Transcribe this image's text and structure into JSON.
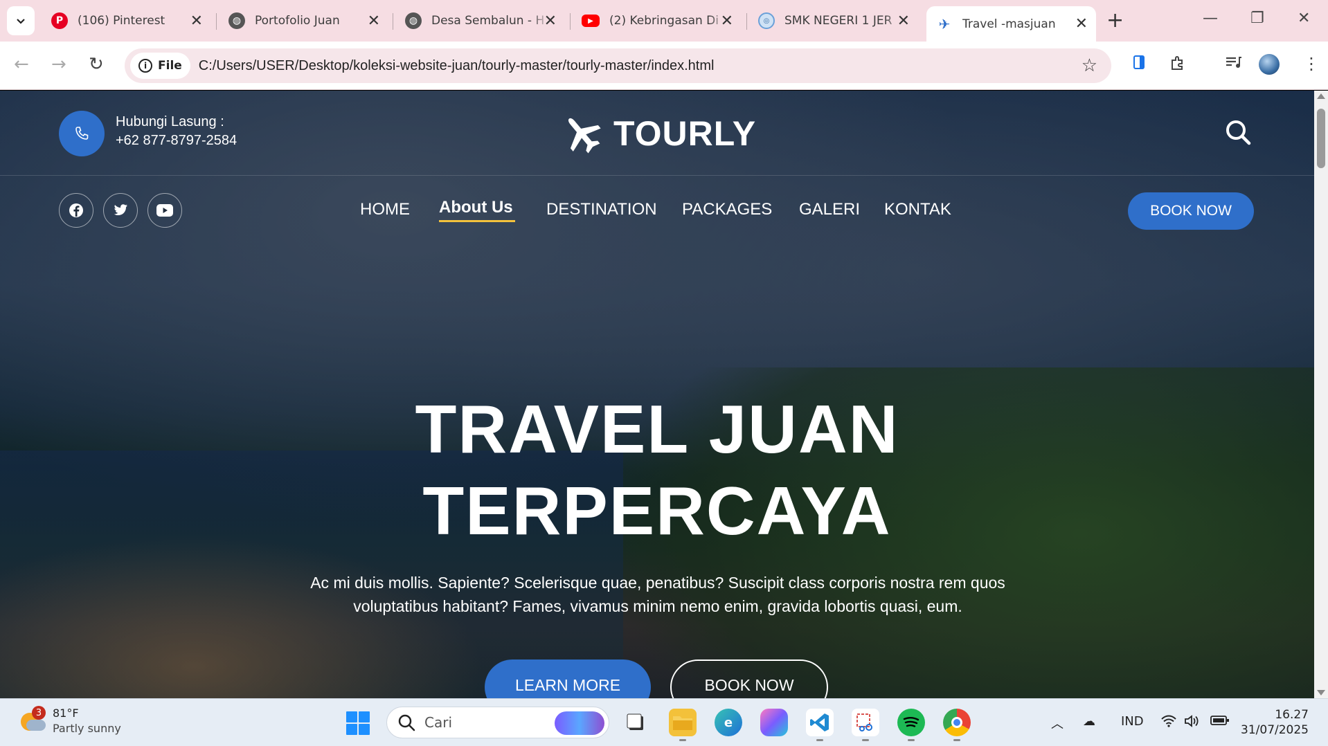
{
  "browser": {
    "tabs": [
      {
        "title": "(106) Pinterest",
        "icon": "pinterest-icon",
        "color": "#e60023"
      },
      {
        "title": "Portofolio Juan",
        "icon": "globe-icon",
        "color": "#555555"
      },
      {
        "title": "Desa Sembalun - H",
        "icon": "globe-icon",
        "color": "#555555"
      },
      {
        "title": "(2) Kebringasan Di",
        "icon": "youtube-icon",
        "color": "#ff0000"
      },
      {
        "title": "SMK NEGERI 1 JER",
        "icon": "school-icon",
        "color": "#6aa0d8"
      },
      {
        "title": "Travel -masjuan",
        "icon": "plane-icon",
        "color": "#2f6fca"
      }
    ],
    "new_tab": "+",
    "site_chip": "File",
    "url": "C:/Users/USER/Desktop/koleksi-website-juan/tourly-master/tourly-master/index.html"
  },
  "site": {
    "contact_label": "Hubungi Lasung :",
    "contact_phone": "+62 877-8797-2584",
    "logo": "TOURLY",
    "social": [
      "facebook-icon",
      "twitter-icon",
      "youtube-icon"
    ],
    "menu": [
      {
        "label": "HOME",
        "active": false
      },
      {
        "label": "About Us",
        "active": true
      },
      {
        "label": "DESTINATION",
        "active": false
      },
      {
        "label": "PACKAGES",
        "active": false
      },
      {
        "label": "GALERI",
        "active": false
      },
      {
        "label": "KONTAK",
        "active": false
      }
    ],
    "book_now_top": "BOOK NOW",
    "hero": {
      "title_line1": "TRAVEL JUAN",
      "title_line2": "TERPERCAYA",
      "description": "Ac mi duis mollis. Sapiente? Scelerisque quae, penatibus? Suscipit class corporis nostra rem quos voluptatibus habitant? Fames, vivamus minim nemo enim, gravida lobortis quasi, eum.",
      "learn_more": "LEARN MORE",
      "book_now": "BOOK NOW"
    },
    "accent_color": "#2f6fca",
    "underline_color": "#f4c23c"
  },
  "taskbar": {
    "weather_badge": "3",
    "temperature": "81°F",
    "condition": "Partly sunny",
    "search_placeholder": "Cari",
    "language": "IND",
    "time": "16.27",
    "date": "31/07/2025"
  }
}
